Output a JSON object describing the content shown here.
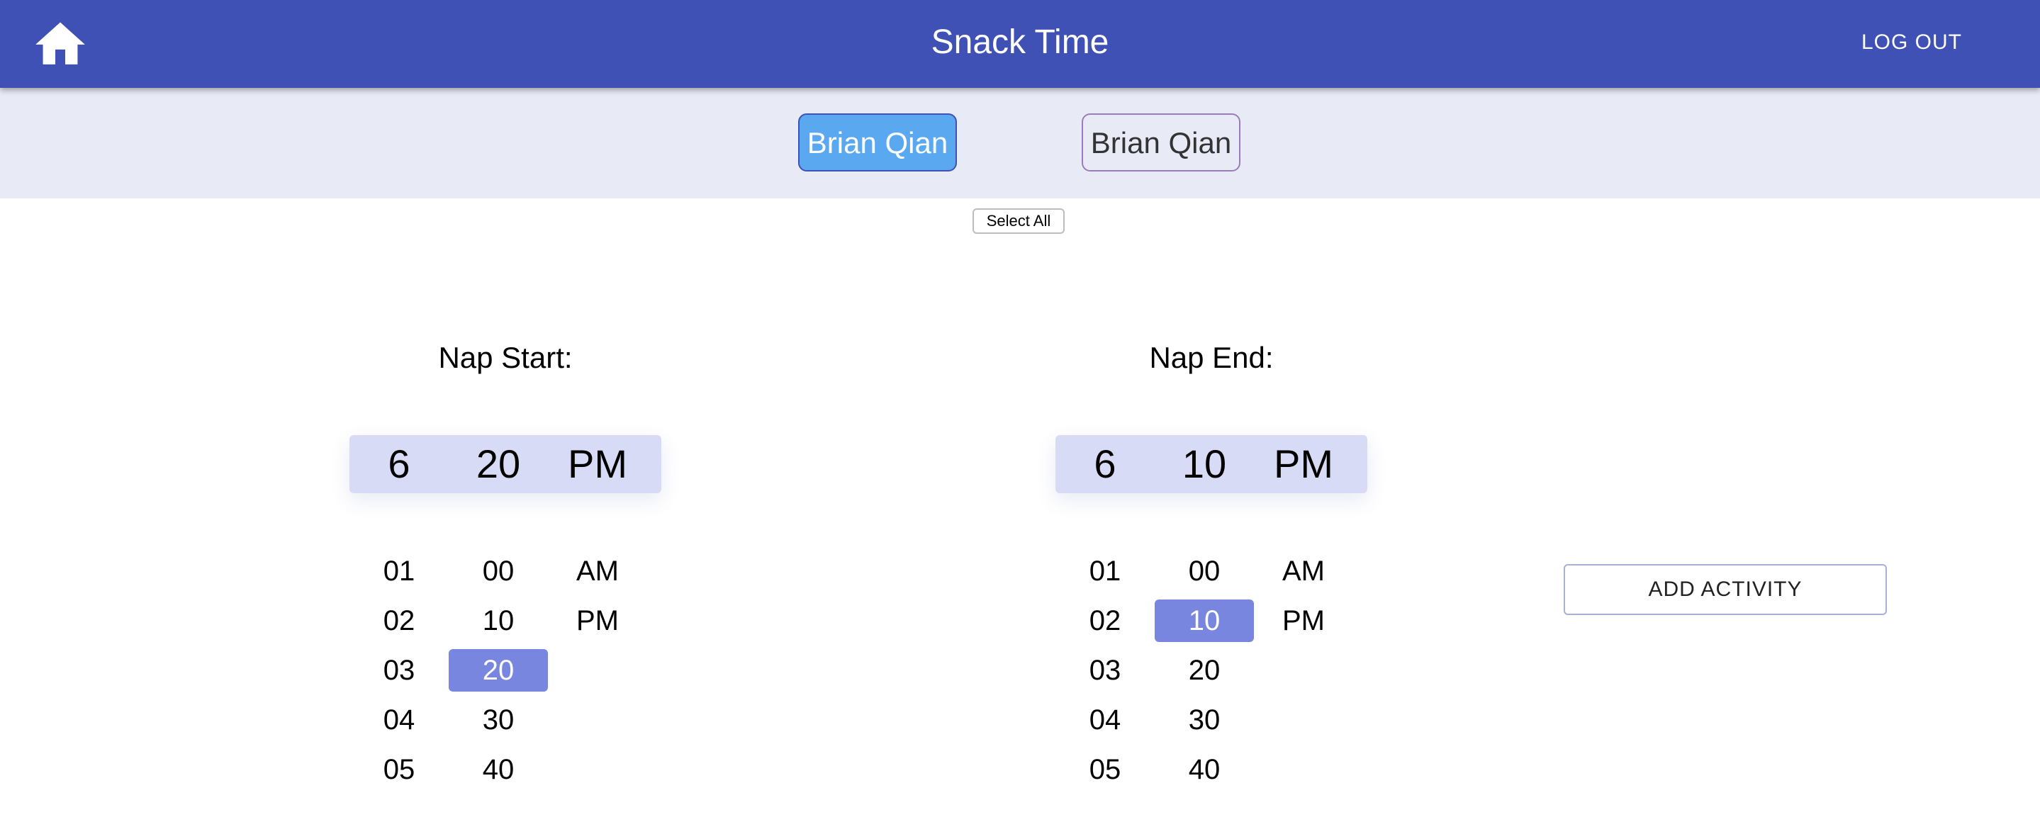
{
  "header": {
    "title": "Snack Time",
    "home_icon": "home-icon",
    "logout_label": "LOG OUT"
  },
  "children": [
    {
      "name": "Brian Qian",
      "selected": true
    },
    {
      "name": "Brian Qian",
      "selected": false
    }
  ],
  "select_all_label": "Select All",
  "nap_start": {
    "label": "Nap Start:",
    "hour": "6",
    "minute": "20",
    "period": "PM",
    "hours": [
      "01",
      "02",
      "03",
      "04",
      "05"
    ],
    "minutes": [
      "00",
      "10",
      "20",
      "30",
      "40"
    ],
    "periods": [
      "AM",
      "PM"
    ],
    "highlighted_minute": "20"
  },
  "nap_end": {
    "label": "Nap End:",
    "hour": "6",
    "minute": "10",
    "period": "PM",
    "hours": [
      "01",
      "02",
      "03",
      "04",
      "05"
    ],
    "minutes": [
      "00",
      "10",
      "20",
      "30",
      "40"
    ],
    "periods": [
      "AM",
      "PM"
    ],
    "highlighted_minute": "10"
  },
  "add_activity_label": "ADD ACTIVITY",
  "colors": {
    "app_bar": "#3f51b5",
    "child_bar": "#e8eaf6",
    "chip_selected": "#5aa9f0",
    "picker_display": "#d8dbf5",
    "picker_highlight": "#7986e0"
  }
}
